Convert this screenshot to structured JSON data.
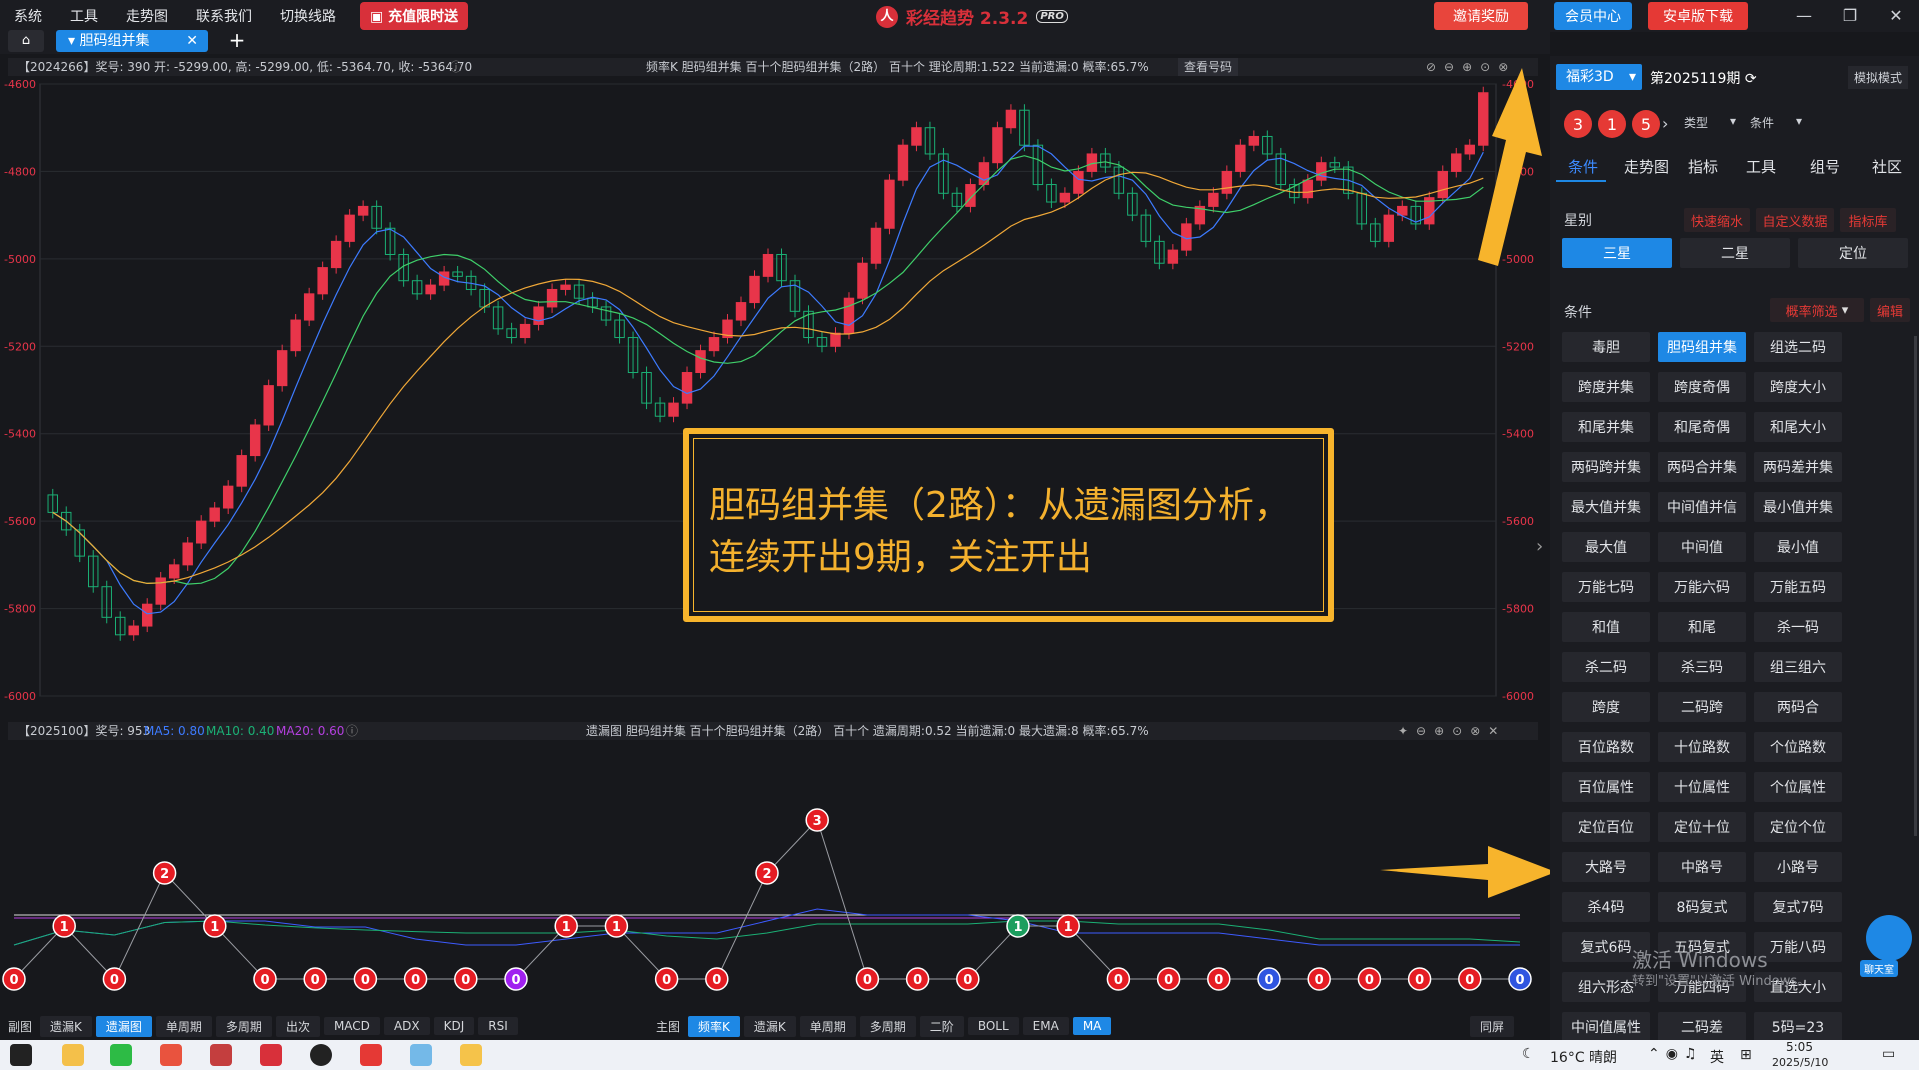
{
  "menu": [
    "系统",
    "工具",
    "走势图",
    "联系我们",
    "切换线路"
  ],
  "promo": "充值限时送",
  "app_title": "彩经趋势 2.3.2",
  "app_badge": "PRO",
  "top_buttons": {
    "invite": "邀请奖励",
    "member": "会员中心",
    "android": "安卓版下载"
  },
  "tab": {
    "active": "胆码组并集"
  },
  "main_info": {
    "left": "【2024266】奖号: 390   开: -5299.00, 高: -5299.00, 低: -5364.70, 收: -5364.70",
    "center": "频率K   胆码组并集   百十个胆码组并集（2路）   百十个   理论周期:1.522   当前遗漏:0   概率:65.7%",
    "link": "查看号码"
  },
  "sub_info": {
    "left": "【2025100】奖号: 953",
    "ma5": "MA5: 0.80",
    "ma10": "MA10: 0.40",
    "ma20": "MA20: 0.60",
    "center": "遗漏图   胆码组并集   百十个胆码组并集（2路）   百十个   遗漏周期:0.52   当前遗漏:0   最大遗漏:8   概率:65.7%"
  },
  "annotation": [
    "胆码组并集（2路）：从遗漏图分析，",
    "连续开出9期，关注开出"
  ],
  "colors": {
    "up": "#e8354a",
    "down": "#1bb075",
    "ma_blue": "#3d7bff",
    "ma_green": "#3fcf6a",
    "ma_orange": "#f0a838",
    "accent": "#1e88e5",
    "callout": "#f7b42c"
  },
  "chart_data": [
    {
      "type": "candlestick",
      "title": "频率K 胆码组并集",
      "ylim": [
        -6000,
        -4600
      ],
      "y_ticks": [
        "-4600",
        "-4800",
        "-5000",
        "-5200",
        "-5400",
        "-5600",
        "-5800",
        "-6000"
      ],
      "series": [
        {
          "name": "close",
          "values": [
            -5580,
            -5620,
            -5680,
            -5750,
            -5820,
            -5860,
            -5840,
            -5790,
            -5730,
            -5700,
            -5650,
            -5600,
            -5570,
            -5520,
            -5450,
            -5380,
            -5290,
            -5210,
            -5140,
            -5080,
            -5020,
            -4960,
            -4900,
            -4880,
            -4930,
            -4990,
            -5050,
            -5080,
            -5060,
            -5030,
            -5040,
            -5070,
            -5110,
            -5160,
            -5180,
            -5150,
            -5110,
            -5070,
            -5060,
            -5090,
            -5110,
            -5140,
            -5180,
            -5260,
            -5330,
            -5360,
            -5330,
            -5260,
            -5210,
            -5180,
            -5140,
            -5100,
            -5040,
            -4990,
            -5050,
            -5120,
            -5180,
            -5200,
            -5170,
            -5090,
            -5010,
            -4930,
            -4820,
            -4740,
            -4700,
            -4760,
            -4850,
            -4880,
            -4830,
            -4780,
            -4700,
            -4660,
            -4740,
            -4830,
            -4870,
            -4850,
            -4800,
            -4760,
            -4790,
            -4850,
            -4900,
            -4960,
            -5010,
            -4980,
            -4920,
            -4880,
            -4850,
            -4800,
            -4740,
            -4720,
            -4760,
            -4830,
            -4860,
            -4820,
            -4780,
            -4790,
            -4850,
            -4920,
            -4960,
            -4900,
            -4880,
            -4920,
            -4860,
            -4800,
            -4760,
            -4740,
            -4620
          ]
        }
      ]
    },
    {
      "type": "line",
      "title": "遗漏图",
      "series": [
        {
          "name": "遗漏",
          "values": [
            0,
            1,
            0,
            2,
            1,
            0,
            0,
            0,
            0,
            0,
            0,
            1,
            1,
            0,
            0,
            2,
            3,
            0,
            0,
            0,
            1,
            1,
            0,
            0,
            0,
            0,
            0,
            0,
            0,
            0,
            0
          ]
        }
      ]
    }
  ],
  "sub_bar": {
    "label": "副图",
    "items": [
      "遗漏K",
      "遗漏图",
      "单周期",
      "多周期",
      "出次",
      "MACD",
      "ADX",
      "KDJ",
      "RSI"
    ],
    "active": "遗漏图"
  },
  "main_bar": {
    "label": "主图",
    "items": [
      "频率K",
      "遗漏K",
      "单周期",
      "多周期",
      "二阶",
      "BOLL",
      "EMA",
      "MA"
    ],
    "active": [
      "频率K",
      "MA"
    ]
  },
  "same_screen": "同屏",
  "right": {
    "lottery": "福彩3D",
    "period": "第2025119期",
    "mode": "模拟模式",
    "balls": [
      "3",
      "1",
      "5"
    ],
    "type_label": "类型",
    "cond_label": "条件",
    "nav": [
      "条件",
      "走势图",
      "指标",
      "工具",
      "组号",
      "社区"
    ],
    "section1": "星别",
    "links1": [
      "快速缩水",
      "自定义数据",
      "指标库"
    ],
    "stars": [
      "三星",
      "二星",
      "定位"
    ],
    "section2": "条件",
    "filter": "概率筛选",
    "edit": "编辑",
    "grid": [
      "毒胆",
      "胆码组并集",
      "组选二码",
      "跨度并集",
      "跨度奇偶",
      "跨度大小",
      "和尾并集",
      "和尾奇偶",
      "和尾大小",
      "两码跨并集",
      "两码合并集",
      "两码差并集",
      "最大值并集",
      "中间值并信",
      "最小值并集",
      "最大值",
      "中间值",
      "最小值",
      "万能七码",
      "万能六码",
      "万能五码",
      "和值",
      "和尾",
      "杀一码",
      "杀二码",
      "杀三码",
      "组三组六",
      "跨度",
      "二码跨",
      "两码合",
      "百位路数",
      "十位路数",
      "个位路数",
      "百位属性",
      "十位属性",
      "个位属性",
      "定位百位",
      "定位十位",
      "定位个位",
      "大路号",
      "中路号",
      "小路号",
      "杀4码",
      "8码复式",
      "复式7码",
      "复式6码",
      "五码复式",
      "万能八码",
      "组六形态",
      "万能四码",
      "直选大小",
      "中间值属性",
      "二码差",
      "5码=23"
    ]
  },
  "chat": "聊天室",
  "watermark": [
    "激活 Windows",
    "转到\"设置\"以激活 Windows。"
  ],
  "taskbar": {
    "weather": "16°C 晴朗",
    "lang": "英",
    "time": "5:05",
    "date": "2025/5/10"
  }
}
